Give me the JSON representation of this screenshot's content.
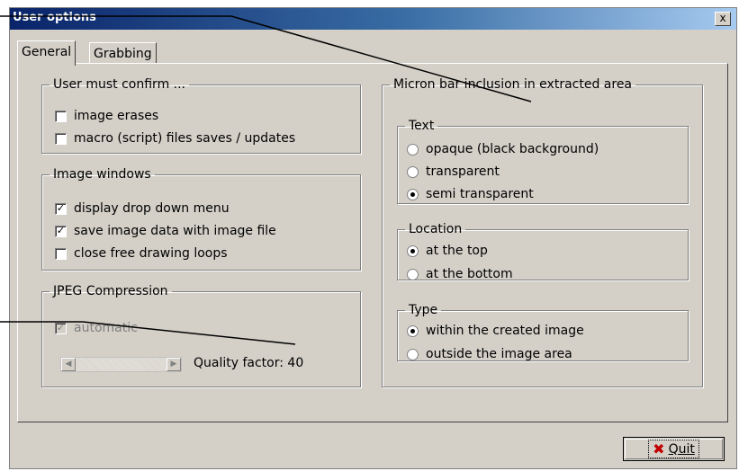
{
  "window": {
    "title": "User options",
    "close_label": "x"
  },
  "tabs": [
    {
      "label": "General",
      "active": true
    },
    {
      "label": "Grabbing",
      "active": false
    }
  ],
  "user_confirm": {
    "legend": "User must confirm ...",
    "items": [
      {
        "label": "image erases",
        "checked": false
      },
      {
        "label": "macro (script) files saves / updates",
        "checked": false
      }
    ]
  },
  "image_windows": {
    "legend": "Image windows",
    "items": [
      {
        "label": "display drop down menu",
        "checked": true
      },
      {
        "label": "save image data with image file",
        "checked": true
      },
      {
        "label": "close free drawing loops",
        "checked": false
      }
    ]
  },
  "jpeg": {
    "legend": "JPEG Compression",
    "automatic_label": "automatic",
    "automatic_checked": true,
    "quality_label": "Quality factor:",
    "quality_value": "40"
  },
  "micron": {
    "legend": "Micron bar inclusion in extracted area",
    "text": {
      "legend": "Text",
      "options": [
        "opaque (black background)",
        "transparent",
        "semi transparent"
      ],
      "selected": 2
    },
    "location": {
      "legend": "Location",
      "options": [
        "at the top",
        "at the bottom"
      ],
      "selected": 0
    },
    "type": {
      "legend": "Type",
      "options": [
        "within the created image",
        "outside the image area"
      ],
      "selected": 0
    }
  },
  "quit": {
    "label": "Quit"
  },
  "colors": {
    "title_start": "#0a246a",
    "title_end": "#a6caf0",
    "face": "#d4d0c8",
    "quit_icon": "#c00000"
  }
}
